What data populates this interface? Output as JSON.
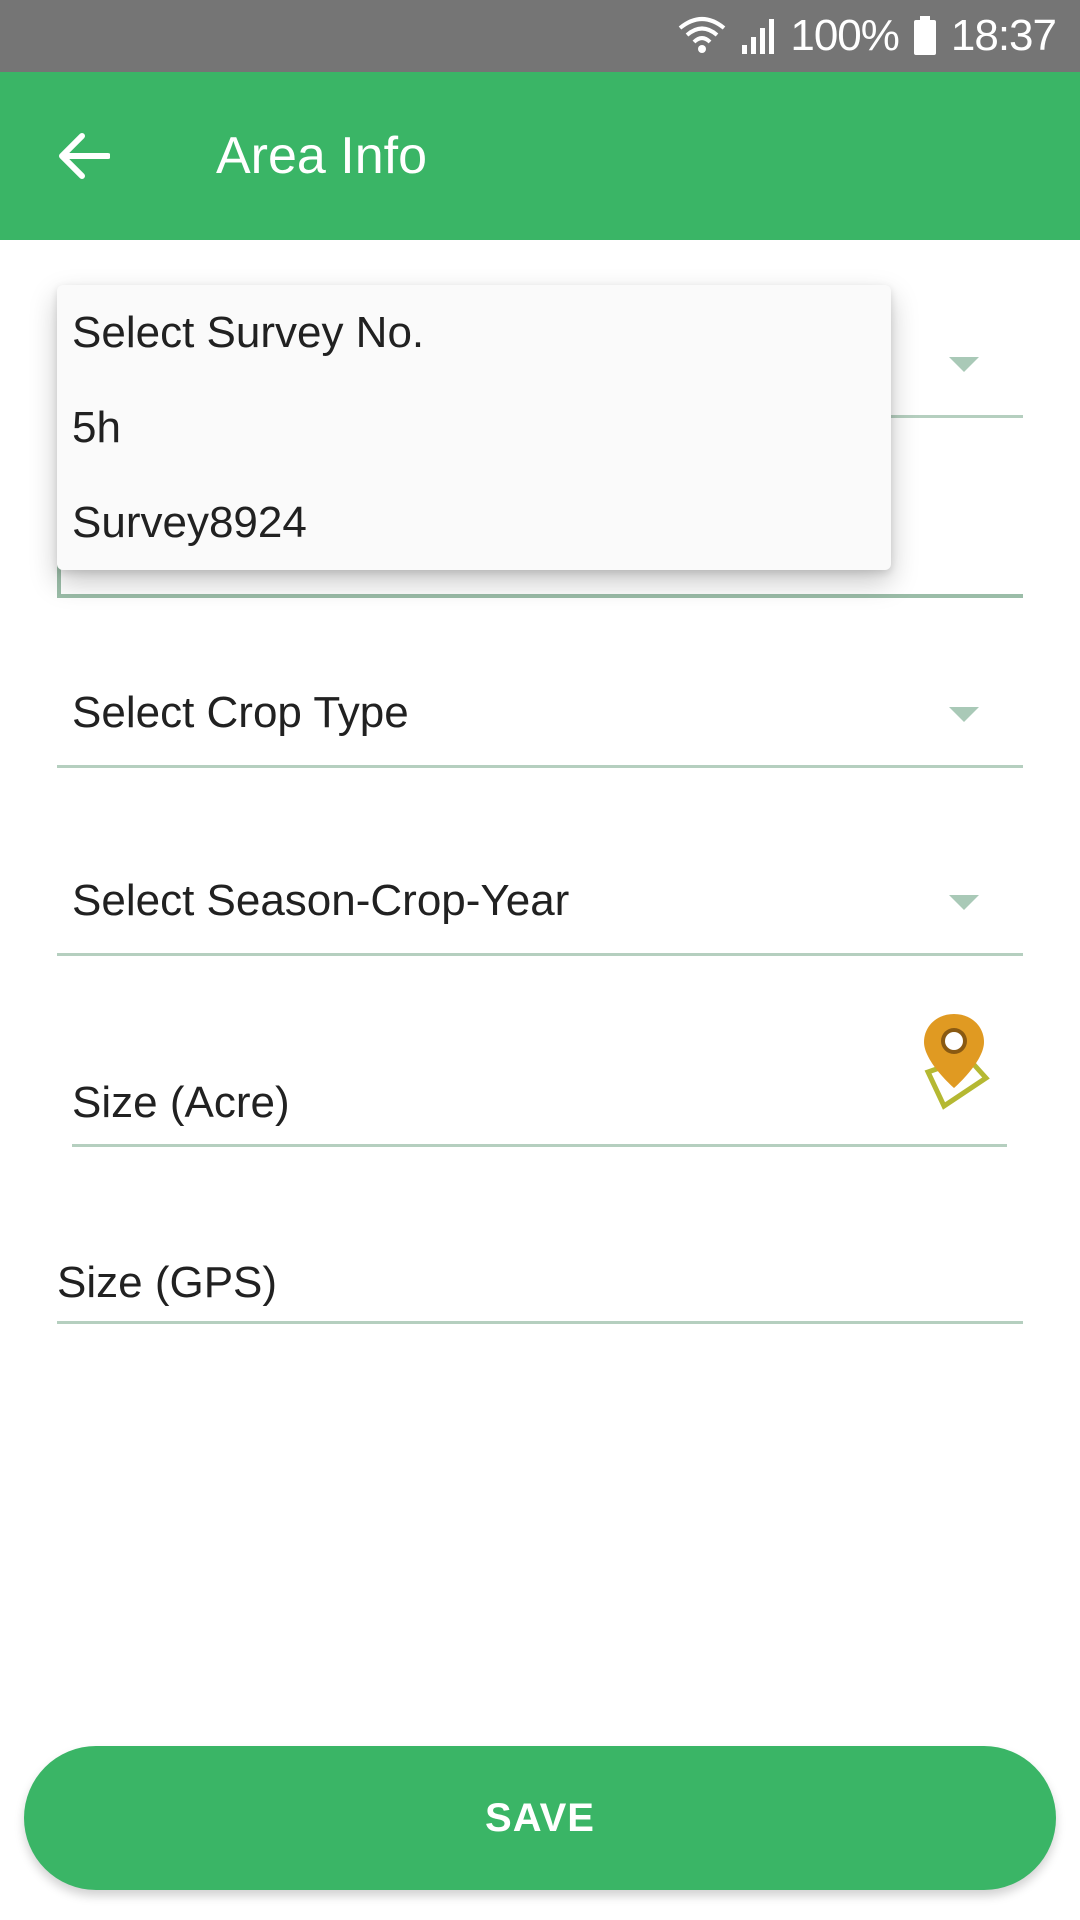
{
  "status_bar": {
    "battery_percent": "100%",
    "time": "18:37",
    "icons": [
      "wifi-icon",
      "signal-icon",
      "battery-icon"
    ]
  },
  "app_bar": {
    "title": "Area Info",
    "back_icon": "arrow-back-icon",
    "color": "#3ab566"
  },
  "form": {
    "survey_select": {
      "value": ""
    },
    "crop_type": {
      "value": "Select Crop Type"
    },
    "season_crop_year": {
      "value": "Select Season-Crop-Year"
    },
    "size_acre": {
      "placeholder": "Size (Acre)"
    },
    "size_gps": {
      "placeholder": "Size (GPS)"
    },
    "location_icon": "map-pin-icon"
  },
  "dropdown": {
    "options": [
      "Select Survey No.",
      "5h",
      "Survey8924"
    ]
  },
  "save_button": {
    "label": "SAVE"
  }
}
